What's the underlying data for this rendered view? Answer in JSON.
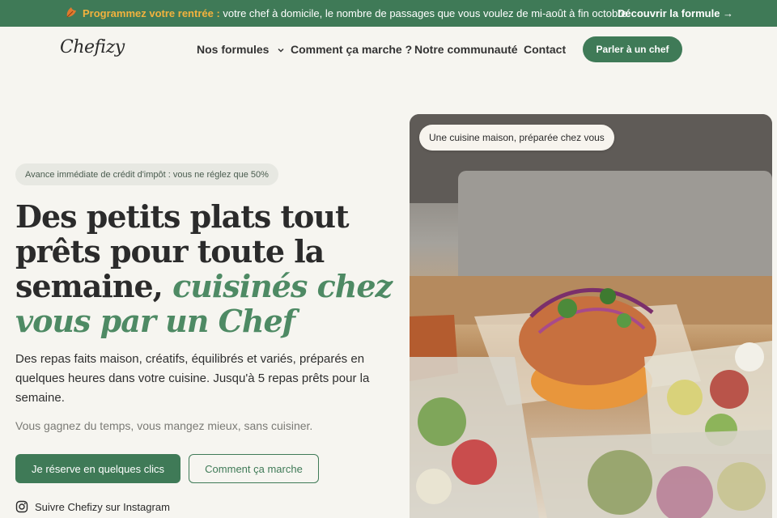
{
  "promo": {
    "highlight": "Programmez votre rentrée :",
    "text": " votre chef à domicile, le nombre de passages que vous voulez de mi-août à fin octobre.",
    "cta": "Découvrir la formule →"
  },
  "header": {
    "logo": "Chefizy",
    "nav": [
      "Nos formules",
      "Comment ça marche ?",
      "Notre communauté",
      "Contact"
    ],
    "cta": "Parler à un chef"
  },
  "hero": {
    "badge": "Avance immédiate de crédit d'impôt : vous ne réglez que 50%",
    "headline_plain": "Des petits plats tout prêts pour toute la semaine, ",
    "headline_accent": "cuisinés chez vous par un Chef",
    "description": "Des repas faits maison, créatifs, équilibrés et variés, préparés en quelques heures dans votre cuisine. Jusqu'à 5 repas prêts pour la semaine.",
    "sub": "Vous gagnez du temps, vous mangez mieux, sans cuisiner.",
    "primary_button": "Je réserve en quelques clics",
    "secondary_button": "Comment ça marche",
    "instagram": "Suivre Chefizy sur Instagram",
    "photo_caption": "Une cuisine maison, préparée chez vous"
  },
  "colors": {
    "brand_green": "#3f7a57",
    "accent_orange": "#f2b23e",
    "page_background": "#f6f5f0"
  }
}
